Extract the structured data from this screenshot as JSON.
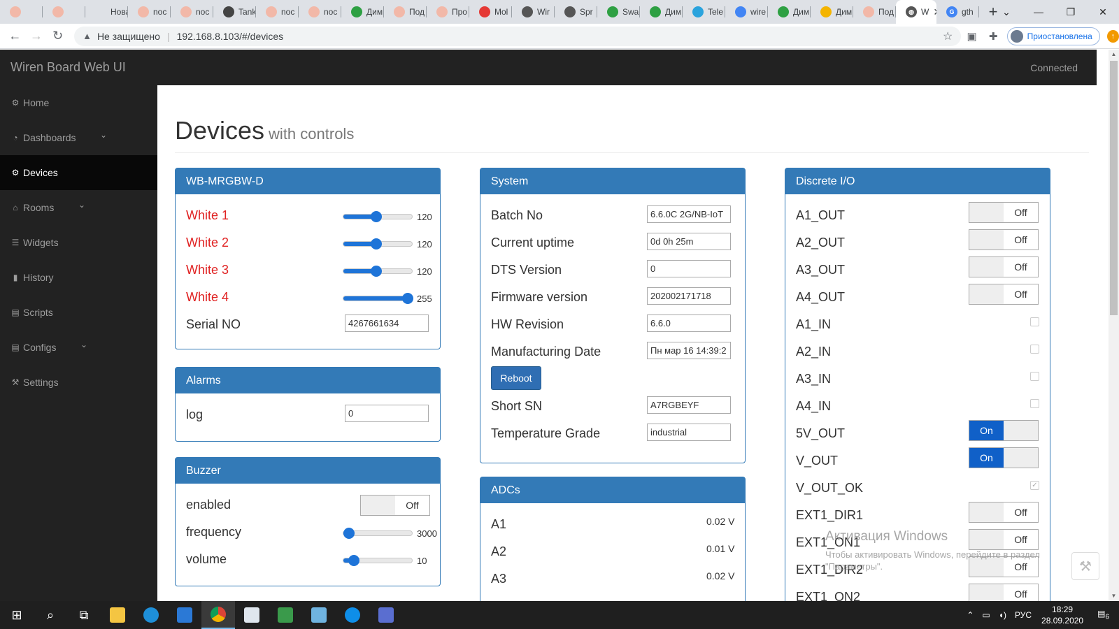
{
  "browser": {
    "tabs": [
      {
        "label": "",
        "color": "#f2b8a8"
      },
      {
        "label": "",
        "color": "#f2b8a8"
      },
      {
        "label": "Новая в",
        "color": ""
      },
      {
        "label": "noc",
        "color": "#f2b8a8"
      },
      {
        "label": "noc",
        "color": "#f2b8a8"
      },
      {
        "label": "Tank",
        "color": "#444444"
      },
      {
        "label": "noc",
        "color": "#f2b8a8"
      },
      {
        "label": "noc",
        "color": "#f2b8a8"
      },
      {
        "label": "Дим",
        "color": "#2ea043"
      },
      {
        "label": "Под",
        "color": "#f2b8a8"
      },
      {
        "label": "Про",
        "color": "#f2b8a8"
      },
      {
        "label": "Mol",
        "color": "#e53935"
      },
      {
        "label": "Wir",
        "color": "#555555"
      },
      {
        "label": "Spr",
        "color": "#555555"
      },
      {
        "label": "Swa",
        "color": "#2ea043"
      },
      {
        "label": "Дим",
        "color": "#2ea043"
      },
      {
        "label": "Tele",
        "color": "#2aa3dd"
      },
      {
        "label": "wire",
        "color": "#4285f4"
      },
      {
        "label": "Дим",
        "color": "#2ea043"
      },
      {
        "label": "Дим",
        "color": "#f4b400"
      },
      {
        "label": "Под",
        "color": "#f2b8a8"
      }
    ],
    "active_tab_label": "W",
    "after_tab_label": "gth",
    "security_label": "Не защищено",
    "url": "192.168.8.103/#/devices",
    "profile_label": "Приостановлена"
  },
  "app": {
    "brand": "Wiren Board Web UI",
    "status": "Connected",
    "sidebar": [
      {
        "label": "Home",
        "icon": "gear-icon",
        "glyph": "⚙"
      },
      {
        "label": "Dashboards",
        "icon": "dashboard-icon",
        "glyph": "◔",
        "expand": true
      },
      {
        "label": "Devices",
        "icon": "gear-icon",
        "glyph": "⚙",
        "active": true
      },
      {
        "label": "Rooms",
        "icon": "home-icon",
        "glyph": "⌂",
        "expand": true
      },
      {
        "label": "Widgets",
        "icon": "list-icon",
        "glyph": "☰"
      },
      {
        "label": "History",
        "icon": "bar-chart-icon",
        "glyph": "▮"
      },
      {
        "label": "Scripts",
        "icon": "file-icon",
        "glyph": "▤"
      },
      {
        "label": "Configs",
        "icon": "file-icon",
        "glyph": "▤",
        "expand": true
      },
      {
        "label": "Settings",
        "icon": "wrench-icon",
        "glyph": "⚒"
      }
    ],
    "page_title": "Devices",
    "page_subtitle": "with controls",
    "accent": "#337ab7",
    "mrgbw": {
      "title": "WB-MRGBW-D",
      "sliders": [
        {
          "label": "White 1",
          "value": "120",
          "fraction": 0.47
        },
        {
          "label": "White 2",
          "value": "120",
          "fraction": 0.47
        },
        {
          "label": "White 3",
          "value": "120",
          "fraction": 0.47
        },
        {
          "label": "White 4",
          "value": "255",
          "fraction": 1.0
        }
      ],
      "serial_label": "Serial NO",
      "serial_value": "4267661634"
    },
    "alarms": {
      "title": "Alarms",
      "log_label": "log",
      "log_value": "0"
    },
    "buzzer": {
      "title": "Buzzer",
      "enabled_label": "enabled",
      "enabled_state": "Off",
      "frequency_label": "frequency",
      "frequency_value": "3000",
      "frequency_fraction": 0.0,
      "volume_label": "volume",
      "volume_value": "10",
      "volume_fraction": 0.08
    },
    "system": {
      "title": "System",
      "fields": [
        {
          "label": "Batch No",
          "value": "6.6.0C 2G/NB-IoT"
        },
        {
          "label": "Current uptime",
          "value": "0d 0h 25m"
        },
        {
          "label": "DTS Version",
          "value": "0"
        },
        {
          "label": "Firmware version",
          "value": "202002171718"
        },
        {
          "label": "HW Revision",
          "value": "6.6.0"
        },
        {
          "label": "Manufacturing Date",
          "value": "Пн мар 16 14:39:2"
        }
      ],
      "reboot_label": "Reboot",
      "fields_after": [
        {
          "label": "Short SN",
          "value": "A7RGBEYF"
        },
        {
          "label": "Temperature Grade",
          "value": "industrial"
        }
      ]
    },
    "adcs": {
      "title": "ADCs",
      "rows": [
        {
          "label": "A1",
          "value": "0.02 V"
        },
        {
          "label": "A2",
          "value": "0.01 V"
        },
        {
          "label": "A3",
          "value": "0.02 V"
        }
      ]
    },
    "discrete": {
      "title": "Discrete I/O",
      "rows": [
        {
          "label": "A1_OUT",
          "kind": "toggle",
          "state": "Off"
        },
        {
          "label": "A2_OUT",
          "kind": "toggle",
          "state": "Off"
        },
        {
          "label": "A3_OUT",
          "kind": "toggle",
          "state": "Off"
        },
        {
          "label": "A4_OUT",
          "kind": "toggle",
          "state": "Off"
        },
        {
          "label": "A1_IN",
          "kind": "check",
          "checked": false
        },
        {
          "label": "A2_IN",
          "kind": "check",
          "checked": false
        },
        {
          "label": "A3_IN",
          "kind": "check",
          "checked": false
        },
        {
          "label": "A4_IN",
          "kind": "check",
          "checked": false
        },
        {
          "label": "5V_OUT",
          "kind": "toggle",
          "state": "On"
        },
        {
          "label": "V_OUT",
          "kind": "toggle",
          "state": "On"
        },
        {
          "label": "V_OUT_OK",
          "kind": "check",
          "checked": true
        },
        {
          "label": "EXT1_DIR1",
          "kind": "toggle",
          "state": "Off"
        },
        {
          "label": "EXT1_ON1",
          "kind": "toggle",
          "state": "Off"
        },
        {
          "label": "EXT1_DIR2",
          "kind": "toggle",
          "state": "Off"
        },
        {
          "label": "EXT1_ON2",
          "kind": "toggle",
          "state": "Off"
        }
      ]
    }
  },
  "windows_activation": {
    "title": "Активация Windows",
    "line1": "Чтобы активировать Windows, перейдите в раздел",
    "line2": "\"Параметры\"."
  },
  "taskbar": {
    "lang": "РУС",
    "time": "18:29",
    "date": "28.09.2020",
    "notifications": "6"
  }
}
